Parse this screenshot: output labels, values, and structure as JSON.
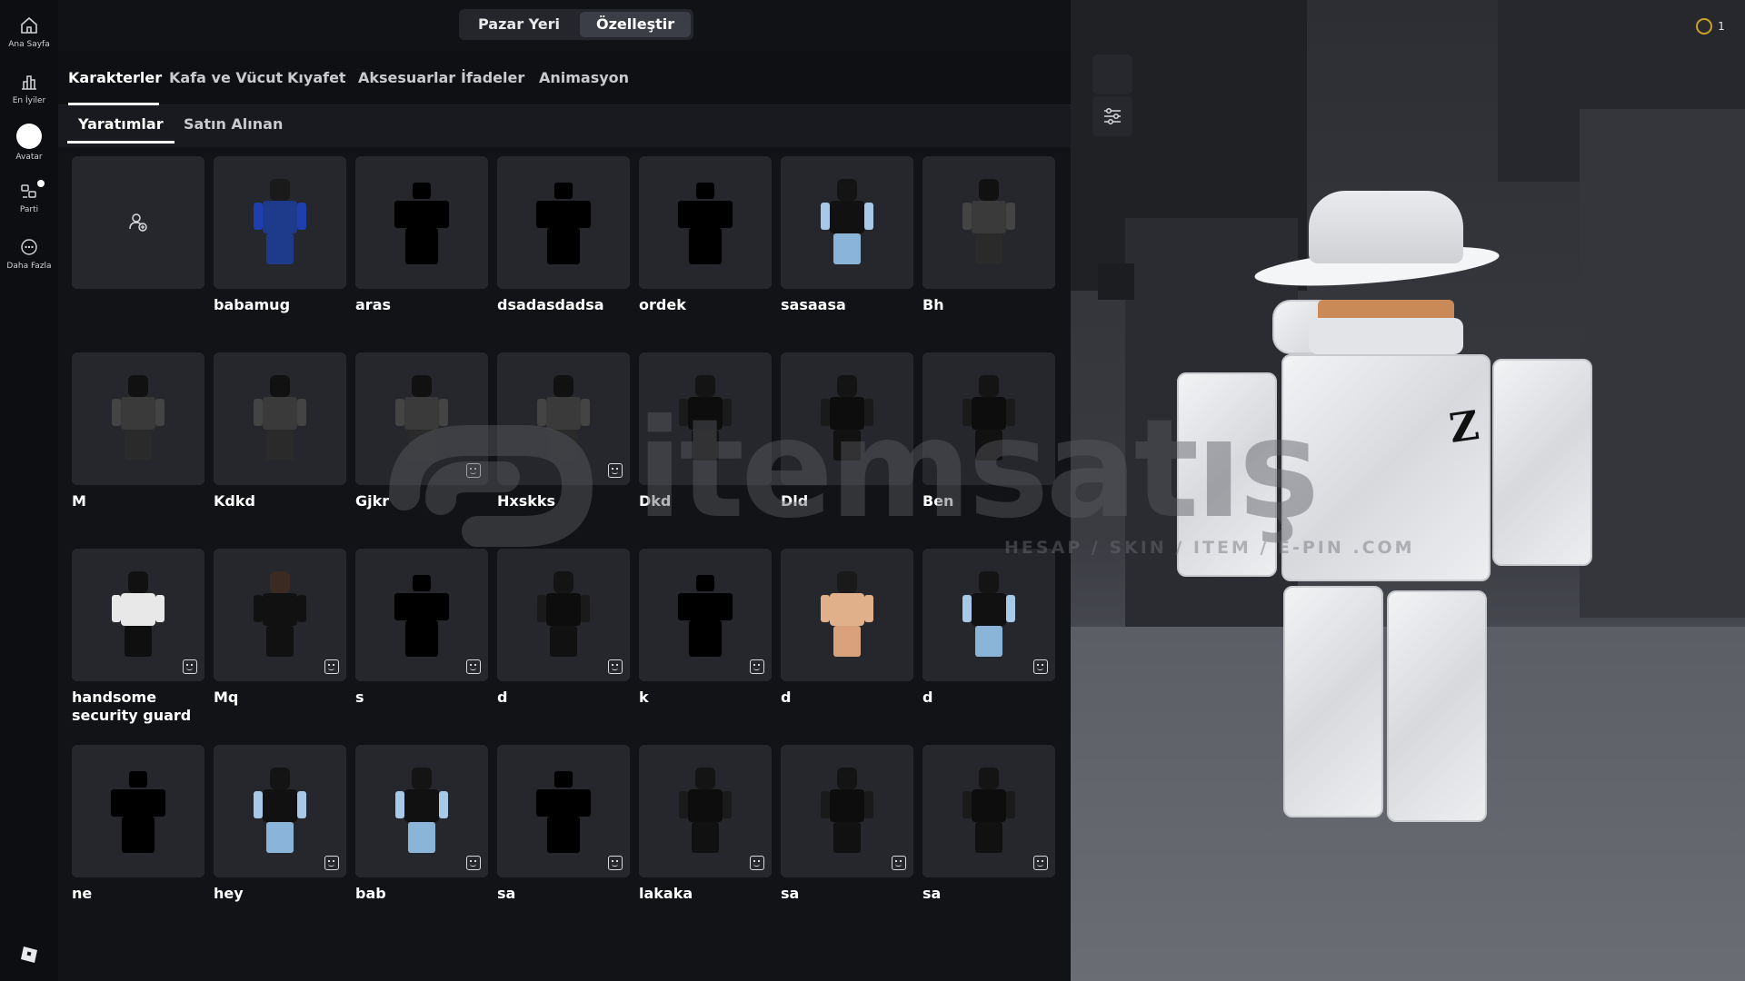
{
  "rail": {
    "home": "Ana Sayfa",
    "charts": "En İyiler",
    "avatar": "Avatar",
    "party": "Parti",
    "more": "Daha Fazla"
  },
  "top_tabs": [
    "Pazar Yeri",
    "Özelleştir"
  ],
  "categories": [
    "Karakterler",
    "Kafa ve Vücut",
    "Kıyafet",
    "Aksesuarlar",
    "İfadeler",
    "Animasyon"
  ],
  "sub_tabs": [
    "Yaratımlar",
    "Satın Alınan"
  ],
  "robux": "1",
  "watermark": {
    "brand": "itemsatış",
    "tagline": "HESAP / SKIN / ITEM / E-PIN .COM"
  },
  "items": [
    {
      "name": "",
      "kind": "create"
    },
    {
      "name": "babamug",
      "kind": "blue"
    },
    {
      "name": "aras",
      "kind": "sil"
    },
    {
      "name": "dsadasdadsa",
      "kind": "sil"
    },
    {
      "name": "ordek",
      "kind": "sil"
    },
    {
      "name": "sasaasa",
      "kind": "wing"
    },
    {
      "name": "Bh",
      "kind": "stripe"
    },
    {
      "name": "M",
      "kind": "stripe"
    },
    {
      "name": "Kdkd",
      "kind": "stripe"
    },
    {
      "name": "Gjkr",
      "kind": "stripe",
      "badge": true
    },
    {
      "name": "Hxskks",
      "kind": "stripe",
      "badge": true
    },
    {
      "name": "Dkd",
      "kind": "black"
    },
    {
      "name": "Dld",
      "kind": "black"
    },
    {
      "name": "Ben",
      "kind": "black"
    },
    {
      "name": "handsome security guard",
      "kind": "white",
      "badge": true
    },
    {
      "name": "Mq",
      "kind": "suit",
      "badge": true
    },
    {
      "name": "s",
      "kind": "sil",
      "badge": true
    },
    {
      "name": "d",
      "kind": "black",
      "badge": true
    },
    {
      "name": "k",
      "kind": "sil",
      "badge": true
    },
    {
      "name": "d",
      "kind": "skin"
    },
    {
      "name": "d",
      "kind": "wing",
      "badge": true
    },
    {
      "name": "ne",
      "kind": "sil"
    },
    {
      "name": "hey",
      "kind": "wing",
      "badge": true
    },
    {
      "name": "bab",
      "kind": "wing",
      "badge": true
    },
    {
      "name": "sa",
      "kind": "sil",
      "badge": true
    },
    {
      "name": "lakaka",
      "kind": "black",
      "badge": true
    },
    {
      "name": "sa",
      "kind": "black",
      "badge": true
    },
    {
      "name": "sa",
      "kind": "black",
      "badge": true
    }
  ]
}
